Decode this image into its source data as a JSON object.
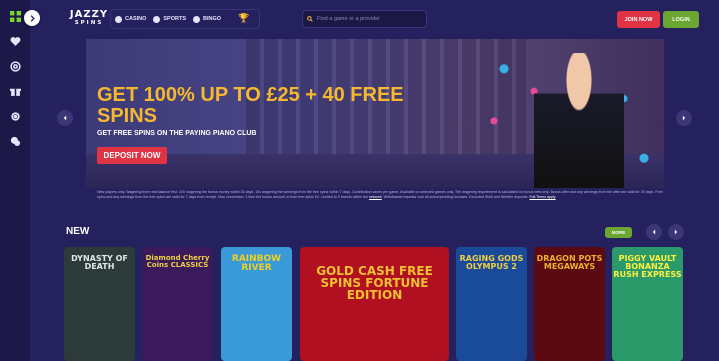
{
  "header": {
    "logo_main": "JAZZY",
    "logo_sub": "SPINS",
    "nav": [
      {
        "label": "CASINO"
      },
      {
        "label": "SPORTS"
      },
      {
        "label": "BINGO"
      }
    ],
    "search_placeholder": "Find a game or a provider",
    "join_label": "JOIN NOW",
    "login_label": "LOGIN"
  },
  "sidebar": {
    "icons": [
      "grid-icon",
      "heart-icon",
      "casino-chip-icon",
      "gift-icon",
      "gear-icon",
      "chat-icon"
    ]
  },
  "hero": {
    "title": "GET 100% UP TO £25 + 40 FREE SPINS",
    "subtitle": "GET FREE SPINS ON THE PAYING PIANO CLUB",
    "cta_label": "DEPOSIT NOW"
  },
  "terms": {
    "text": "New players only. Wagering from real balance first. 10X wagering the bonus money within 30 days. 10x wagering the winnings from the free spins within 7 days. Contribution varies per game. Available on selected games only. The wagering requirement is calculated on bonus bets only. Bonus offer and any winnings from the offer are valid for 30 days. Free spins and any winnings from the free spins are valid for 7 days from receipt. Max conversion: 1 time the bonus amount or from free spins £X. Limited to 5 brands within the",
    "link1": "network",
    "text2": ". Withdrawal requests void all active/pending bonuses. Excluded Skrill and Neteller deposits.",
    "link2": "Full Terms apply"
  },
  "section": {
    "title": "NEW",
    "more_label": "MORE"
  },
  "games": [
    {
      "name": "DYNASTY OF DEATH",
      "bg": "#2d3a3a"
    },
    {
      "name": "Diamond Cherry Coins CLASSICS",
      "bg": "#3a1a5a"
    },
    {
      "name": "RAINBOW RIVER",
      "bg": "#3a9ad8"
    },
    {
      "name": "GOLD CASH FREE SPINS FORTUNE EDITION",
      "bg": "#b01020"
    },
    {
      "name": "RAGING GODS OLYMPUS 2",
      "bg": "#1a4a9a"
    },
    {
      "name": "DRAGON POTS MEGAWAYS",
      "bg": "#5a0a10"
    },
    {
      "name": "PIGGY VAULT BONANZA RUSH EXPRESS",
      "bg": "#2a9a6a"
    }
  ]
}
